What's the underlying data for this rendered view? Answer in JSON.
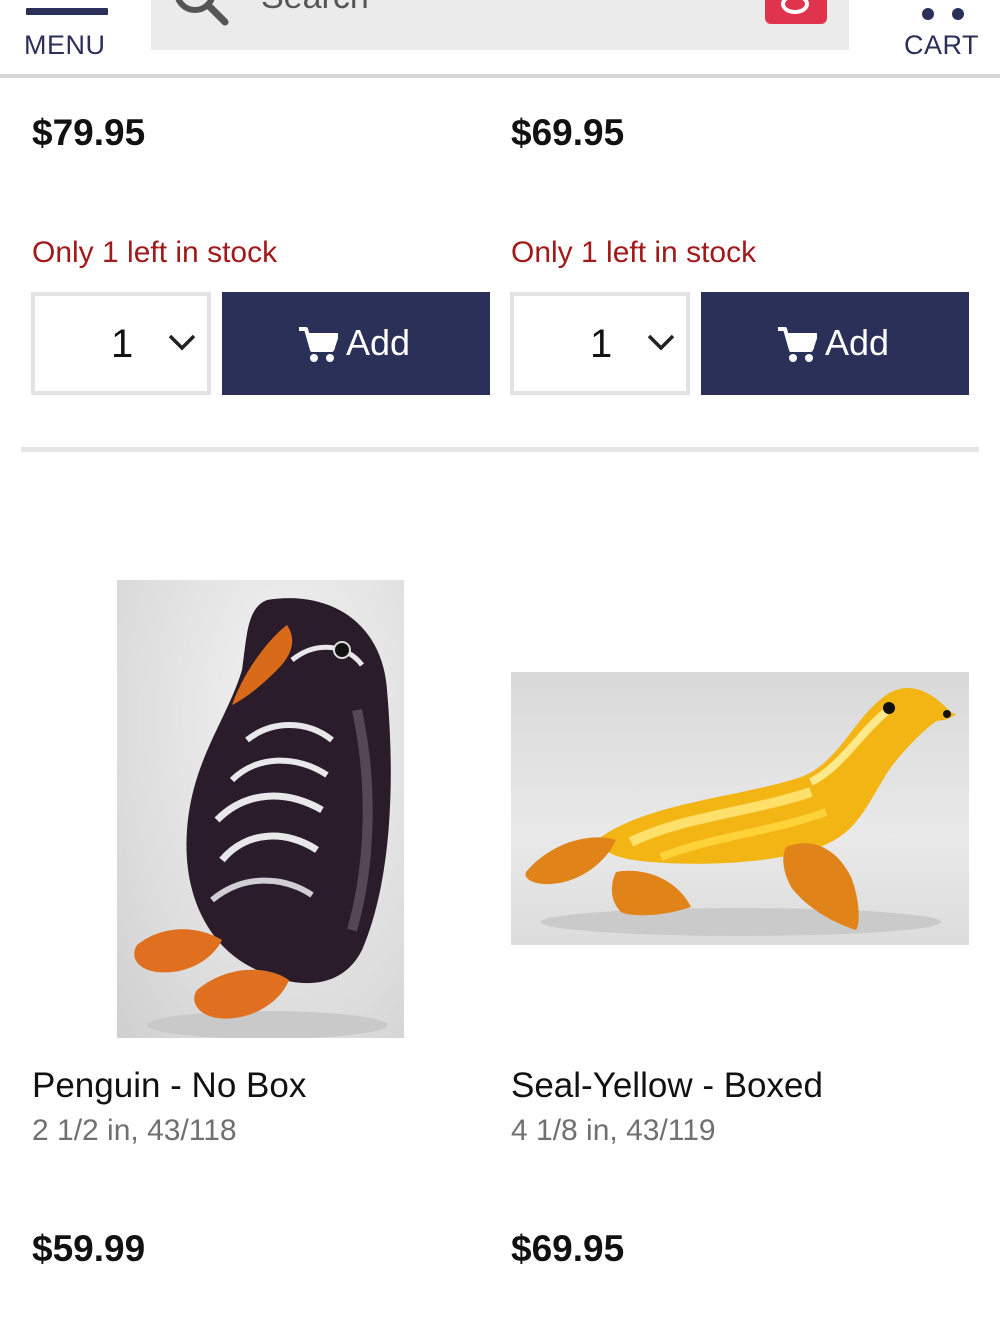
{
  "header": {
    "menu_label": "MENU",
    "search_placeholder": "Search",
    "cart_label": "CART"
  },
  "colors": {
    "brand_navy": "#2b3059",
    "stock_red": "#a31818",
    "search_accent": "#e0344c"
  },
  "top_row": [
    {
      "price": "$79.95",
      "stock": "Only 1 left in stock",
      "qty": "1",
      "add_label": "Add"
    },
    {
      "price": "$69.95",
      "stock": "Only 1 left in stock",
      "qty": "1",
      "add_label": "Add"
    }
  ],
  "products": [
    {
      "image": "penguin-glass-figurine",
      "title": "Penguin - No Box",
      "subtitle": "2 1/2 in, 43/118",
      "price": "$59.99"
    },
    {
      "image": "seal-yellow-glass-figurine",
      "title": "Seal-Yellow - Boxed",
      "subtitle": "4 1/8 in, 43/119",
      "price": "$69.95"
    }
  ]
}
